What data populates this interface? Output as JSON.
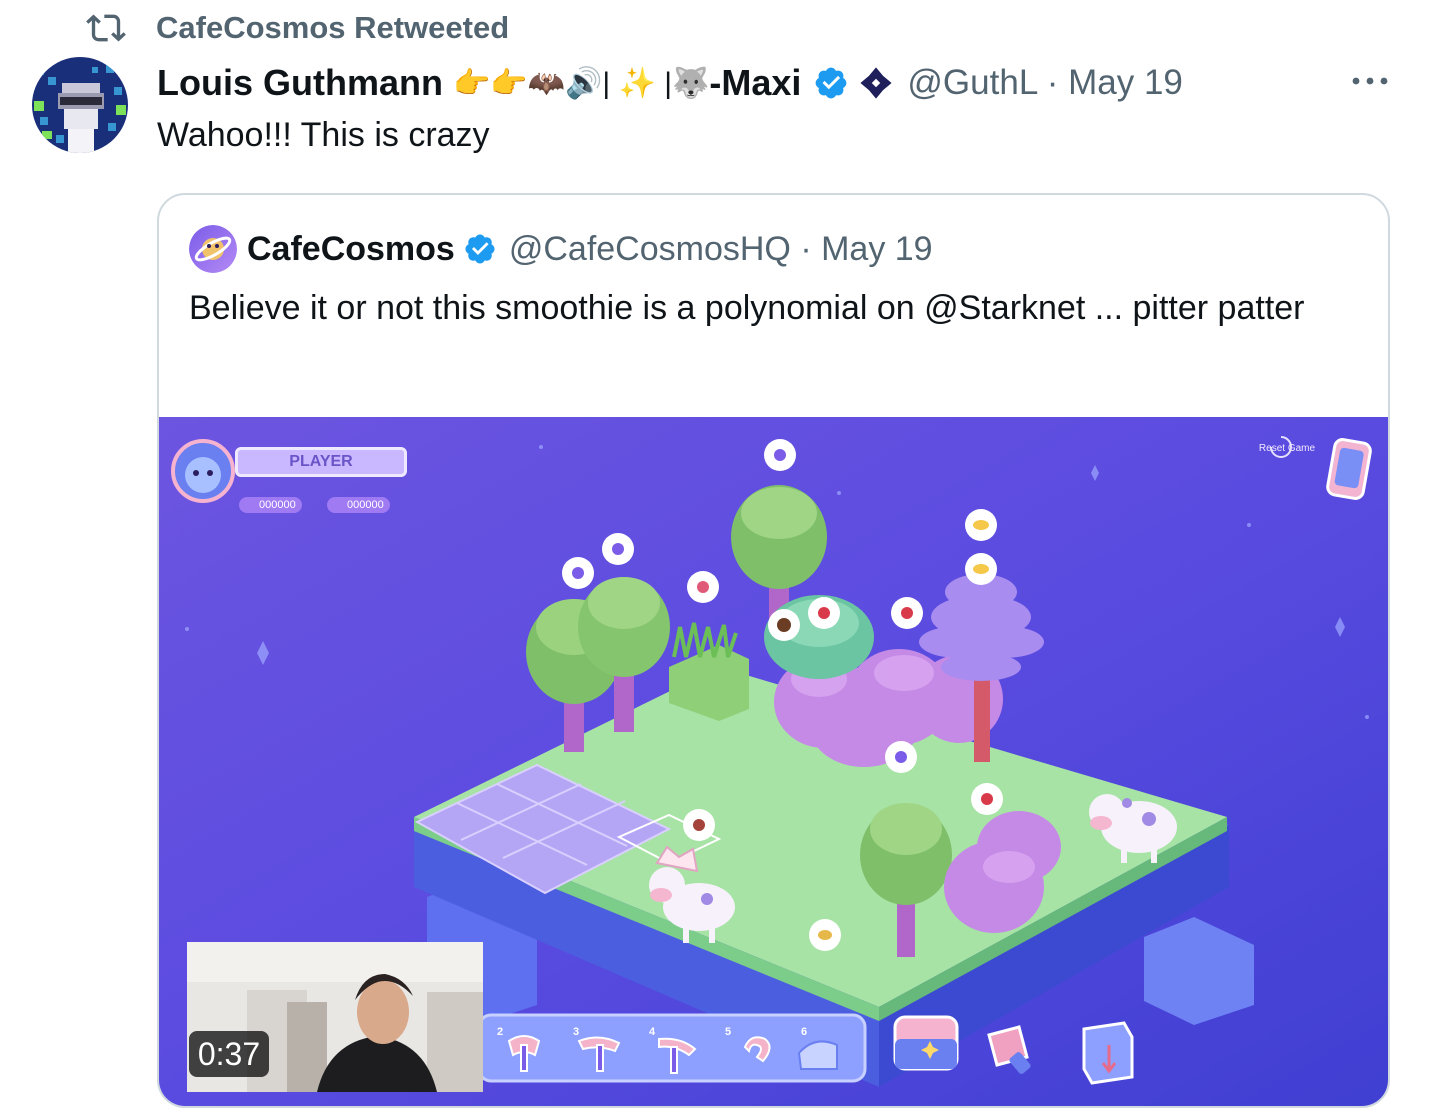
{
  "retweet": {
    "label": "CafeCosmos Retweeted"
  },
  "tweet": {
    "display_name": "Louis Guthmann",
    "name_emojis": "👉👉🦇🔊| ✨ |🐺",
    "name_suffix": "-Maxi",
    "handle": "@GuthL",
    "date_sep": " · ",
    "date": "May 19",
    "text": "Wahoo!!! This is crazy"
  },
  "quote": {
    "display_name": "CafeCosmos",
    "handle": "@CafeCosmosHQ",
    "date_sep": " · ",
    "date": "May 19",
    "text": "Believe it or not this smoothie is a polynomial on @Starknet ... pitter patter"
  },
  "game": {
    "player_label": "PLAYER",
    "coins": "000000",
    "cosmos": "000000",
    "reset_label": "Reset Game",
    "tool_slots": [
      "2",
      "3",
      "4",
      "5",
      "6"
    ]
  },
  "video": {
    "timestamp": "0:37"
  },
  "icons": {
    "retweet": "retweet-icon",
    "verified": "verified-badge-icon",
    "more": "more-options-icon",
    "diamond": "diamond-icon"
  },
  "colors": {
    "verified_blue": "#1d9bf0",
    "secondary_text": "#536471",
    "card_border": "#cfd9de",
    "game_bg_top": "#6a4fe6",
    "game_bg_bottom": "#4a3fd6",
    "grass": "#a7e3a5"
  }
}
